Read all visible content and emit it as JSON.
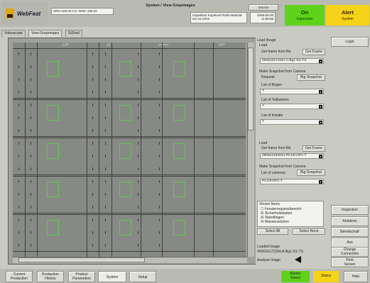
{
  "header": {
    "brand": "WebFeat",
    "title": "System / View Grayimages",
    "version": "WNV-105.03 rc2, WNC-105.03",
    "info": "Inspektion Kopievorl Rolle Material-ein 24 schm",
    "date": "2009-06-00",
    "time": "11:58:58",
    "service_label": "Service",
    "on_title": "On",
    "on_sub": "Inspection",
    "alert_title": "Alert",
    "alert_sub": "System"
  },
  "tabs": [
    "Videoscope",
    "View Grayimages",
    "StShell"
  ],
  "image_view": {
    "column_labels": [
      "CP*",
      "D",
      "=====",
      "CP*"
    ]
  },
  "panel": {
    "load_title": "Load Image",
    "load_label": "Load",
    "get_frame_from_file": "Get frame from file",
    "get_frame_button": "Get Frame",
    "frame_file_1": "000616172334-A-Bg1-D1-TS",
    "make_snapshot": "Make Snapshot from Camera",
    "request_label": "Request",
    "big_snapshot_button": "Big Snapshot",
    "list_bogen_label": "List of Bogen",
    "list_bogen_value": "T",
    "list_teilbahnen_label": "List of Teilbahnen",
    "list_teilbahnen_value": "A",
    "list_kanaele_label": "List of Kanäle",
    "list_kanaele_value": "T",
    "load2_label": "Load",
    "get_frame_from_file_2": "Get frame from file",
    "get_frame_button_2": "Get Frame",
    "frame_file_2": "090622192034-PC1/KVIP1-T",
    "make_snapshot_2": "Make Snapshot from Camera",
    "list_cameras_label": "List of cameras",
    "big_snapshot_button_2": "Big Snapshot",
    "camera_value": "PC1/KVIP1-T",
    "shown_items_title": "Shown Items",
    "shown_items": [
      "Fensterrequenzbereich",
      "Sicherheitsfasten",
      "Standbogen",
      "Wasserzeichen"
    ],
    "shown_items_checked": [
      "☐",
      "☒",
      "☒",
      "☒"
    ],
    "select_all_button": "Select All",
    "select_none_button": "Select None",
    "loaded_image_label": "Loaded Image",
    "loaded_image_value": "000616172334-A-Bg1-D1-TS",
    "analyse_image_label": "Analyse Image"
  },
  "side_buttons": {
    "login": "Login",
    "inspection": "Inspection",
    "anfahren": "Anfahren",
    "bereitschaft": "Bereitschaft",
    "aus": "Aus",
    "change_connection_1": "Change",
    "change_connection_2": "Connection",
    "print_screen_1": "Print",
    "print_screen_2": "Screen"
  },
  "bottom": {
    "current_production_1": "Current",
    "current_production_2": "Production",
    "production_history_1": "Production",
    "production_history_2": "History",
    "product_parameters_1": "Product",
    "product_parameters_2": "Parameters",
    "system": "System",
    "setup": "Setup",
    "marker_status_1": "Marker",
    "marker_status_2": "Status",
    "status": "Status",
    "help": "Help"
  },
  "colors": {
    "on_green": "#5ed21b",
    "alert_yellow": "#f5d318",
    "roi_green": "#5bd44b"
  }
}
